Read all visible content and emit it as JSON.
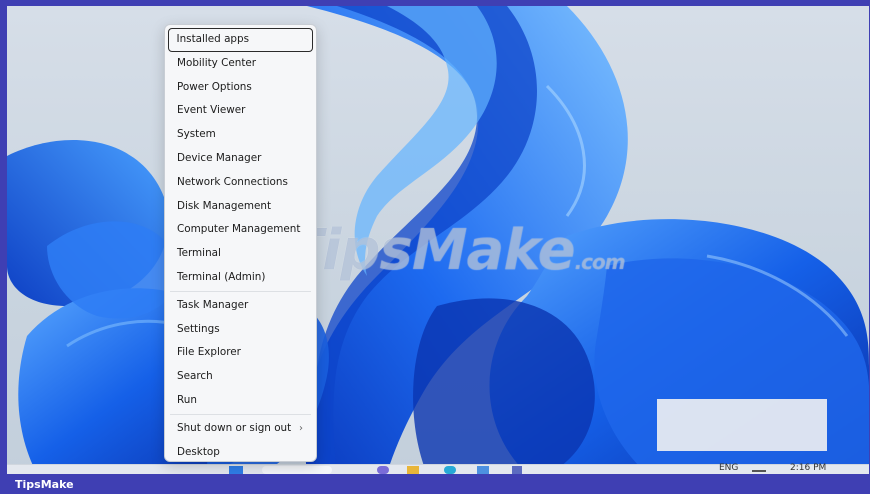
{
  "context_menu": {
    "groups": [
      [
        {
          "label": "Installed apps",
          "name": "menu-item-installed-apps"
        },
        {
          "label": "Mobility Center",
          "name": "menu-item-mobility-center"
        },
        {
          "label": "Power Options",
          "name": "menu-item-power-options"
        },
        {
          "label": "Event Viewer",
          "name": "menu-item-event-viewer"
        },
        {
          "label": "System",
          "name": "menu-item-system"
        },
        {
          "label": "Device Manager",
          "name": "menu-item-device-manager"
        },
        {
          "label": "Network Connections",
          "name": "menu-item-network-connections"
        },
        {
          "label": "Disk Management",
          "name": "menu-item-disk-management"
        },
        {
          "label": "Computer Management",
          "name": "menu-item-computer-management"
        },
        {
          "label": "Terminal",
          "name": "menu-item-terminal"
        },
        {
          "label": "Terminal (Admin)",
          "name": "menu-item-terminal-admin"
        }
      ],
      [
        {
          "label": "Task Manager",
          "name": "menu-item-task-manager"
        },
        {
          "label": "Settings",
          "name": "menu-item-settings"
        },
        {
          "label": "File Explorer",
          "name": "menu-item-file-explorer"
        },
        {
          "label": "Search",
          "name": "menu-item-search"
        },
        {
          "label": "Run",
          "name": "menu-item-run"
        }
      ],
      [
        {
          "label": "Shut down or sign out",
          "name": "menu-item-shut-down",
          "submenu_arrow": "›"
        },
        {
          "label": "Desktop",
          "name": "menu-item-desktop"
        }
      ]
    ],
    "selected_label": "Installed apps"
  },
  "watermark": {
    "main": "TipsMake",
    "suffix": ".com"
  },
  "taskbar": {
    "language": "ENG",
    "time": "2:16 PM"
  },
  "footer": {
    "brand": "TipsMake"
  },
  "colors": {
    "frame": "#3f3fb3",
    "wallpaper_blue": "#1a5fe0",
    "menu_bg": "#f6f7f9"
  }
}
